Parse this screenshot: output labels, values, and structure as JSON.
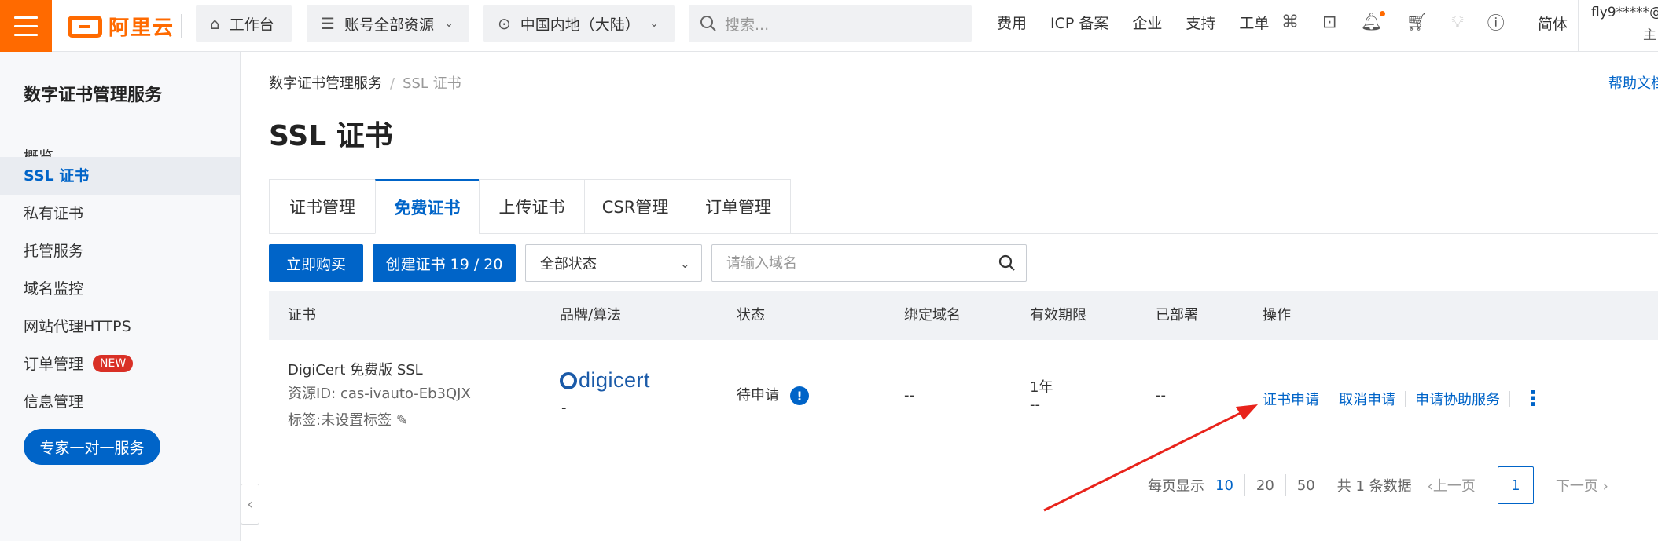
{
  "topbar": {
    "brand": "阿里云",
    "workbench": "工作台",
    "resources": "账号全部资源",
    "region": "中国内地（大陆）",
    "search_placeholder": "搜索...",
    "links": [
      "费用",
      "ICP 备案",
      "企业",
      "支持",
      "工单"
    ],
    "lang": "简体",
    "user": "fly9*****@",
    "user_role": "主"
  },
  "sidebar": {
    "title": "数字证书管理服务",
    "items": [
      {
        "label": "概览"
      },
      {
        "label": "SSL 证书"
      },
      {
        "label": "私有证书"
      },
      {
        "label": "托管服务"
      },
      {
        "label": "域名监控"
      },
      {
        "label": "网站代理HTTPS"
      },
      {
        "label": "订单管理",
        "badge": "NEW"
      },
      {
        "label": "信息管理"
      }
    ],
    "active": "SSL 证书",
    "expert_button": "专家一对一服务"
  },
  "breadcrumb": {
    "root": "数字证书管理服务",
    "current": "SSL 证书"
  },
  "help_link": "帮助文档",
  "page_title": "SSL 证书",
  "tabs": [
    "证书管理",
    "免费证书",
    "上传证书",
    "CSR管理",
    "订单管理"
  ],
  "active_tab": "免费证书",
  "toolbar": {
    "buy_label": "立即购买",
    "create_label": "创建证书 19 / 20",
    "status_select": "全部状态",
    "domain_placeholder": "请输入域名"
  },
  "table": {
    "columns": [
      "证书",
      "品牌/算法",
      "状态",
      "绑定域名",
      "有效期限",
      "已部署",
      "操作"
    ],
    "rows": [
      {
        "name": "DigiCert 免费版 SSL",
        "resource_id": "资源ID: cas-ivauto-Eb3QJX",
        "tag": "标签:未设置标签",
        "brand": "digicert",
        "brand_sub": "-",
        "status": "待申请",
        "domain": "--",
        "validity": "1年",
        "validity_sub": "--",
        "deployed": "--",
        "actions": [
          "证书申请",
          "取消申请",
          "申请协助服务"
        ]
      }
    ]
  },
  "pagination": {
    "per_page_label": "每页显示",
    "sizes": [
      "10",
      "20",
      "50"
    ],
    "selected_size": "10",
    "total": "共 1 条数据",
    "prev": "上一页",
    "current": "1",
    "next": "下一页"
  },
  "colors": {
    "brand_orange": "#ff6a00",
    "primary_blue": "#0064c8",
    "annotation_red": "#e8231b"
  }
}
